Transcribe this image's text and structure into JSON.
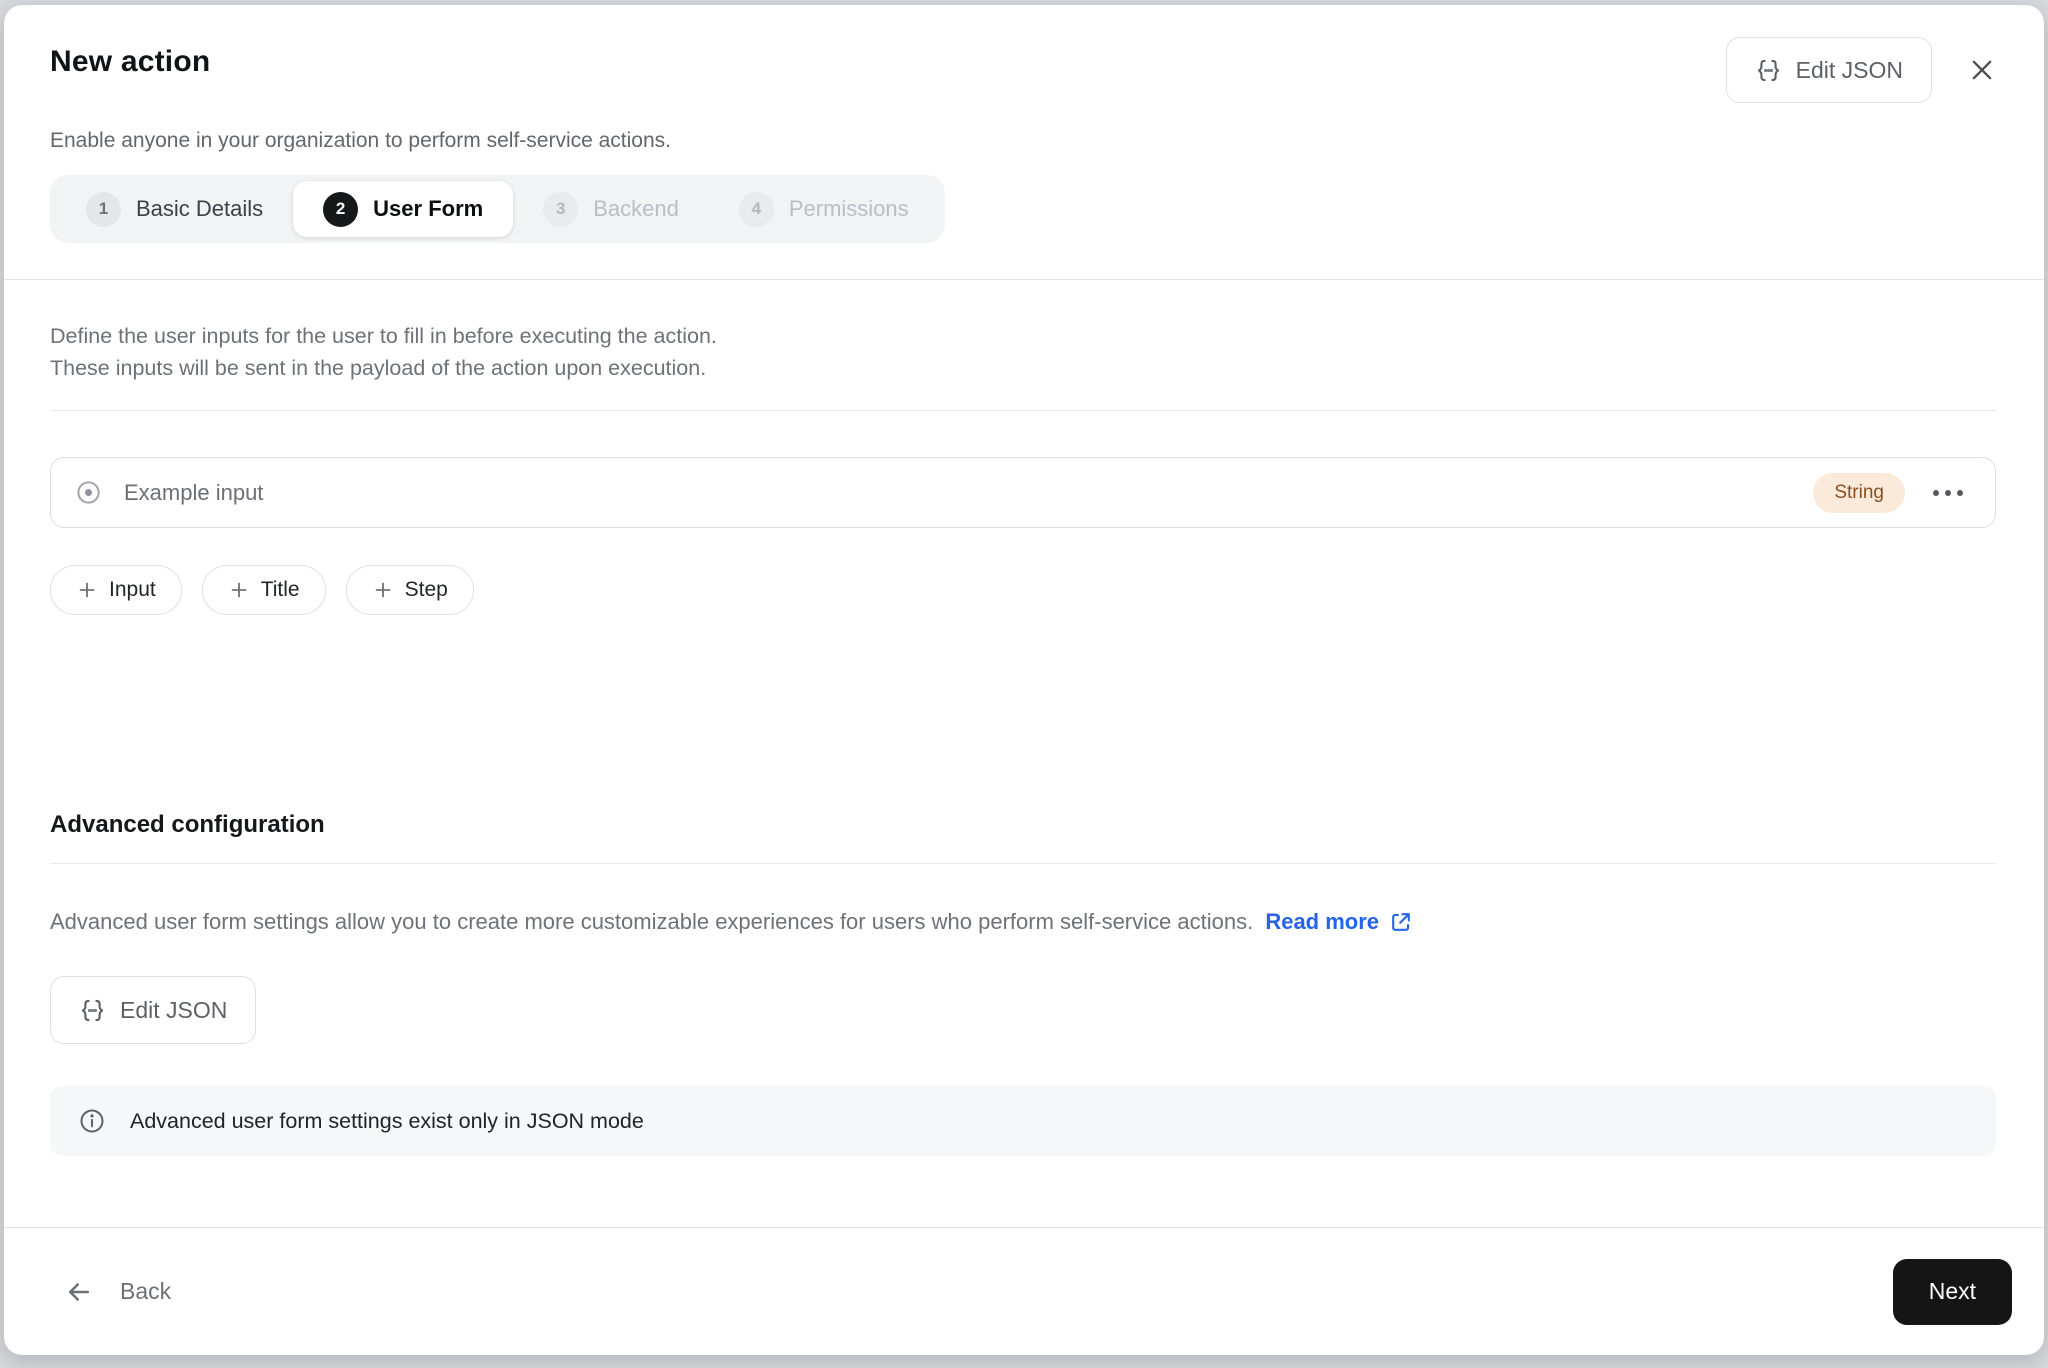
{
  "modal": {
    "title": "New action",
    "subtitle": "Enable anyone in your organization to perform self-service actions.",
    "edit_json_label": "Edit JSON"
  },
  "stepper": {
    "steps": [
      {
        "number": "1",
        "label": "Basic Details",
        "state": "done"
      },
      {
        "number": "2",
        "label": "User Form",
        "state": "active"
      },
      {
        "number": "3",
        "label": "Backend",
        "state": "upcoming"
      },
      {
        "number": "4",
        "label": "Permissions",
        "state": "upcoming"
      }
    ]
  },
  "form": {
    "description_line1": "Define the user inputs for the user to fill in before executing the action.",
    "description_line2": "These inputs will be sent in the payload of the action upon execution.",
    "inputs": [
      {
        "label": "Example input",
        "type": "String"
      }
    ],
    "add_buttons": [
      {
        "label": "Input"
      },
      {
        "label": "Title"
      },
      {
        "label": "Step"
      }
    ]
  },
  "advanced": {
    "heading": "Advanced configuration",
    "description": "Advanced user form settings allow you to create more customizable experiences for users who perform self-service actions.",
    "read_more": "Read more",
    "edit_json_label": "Edit JSON",
    "info_text": "Advanced user form settings exist only in JSON mode"
  },
  "footer": {
    "back": "Back",
    "next": "Next"
  },
  "colors": {
    "accent_blue": "#2563eb",
    "string_badge_bg": "#fbe9da",
    "string_badge_text": "#8a4f21",
    "active_step_bg": "#17181a",
    "next_button_bg": "#151515"
  }
}
